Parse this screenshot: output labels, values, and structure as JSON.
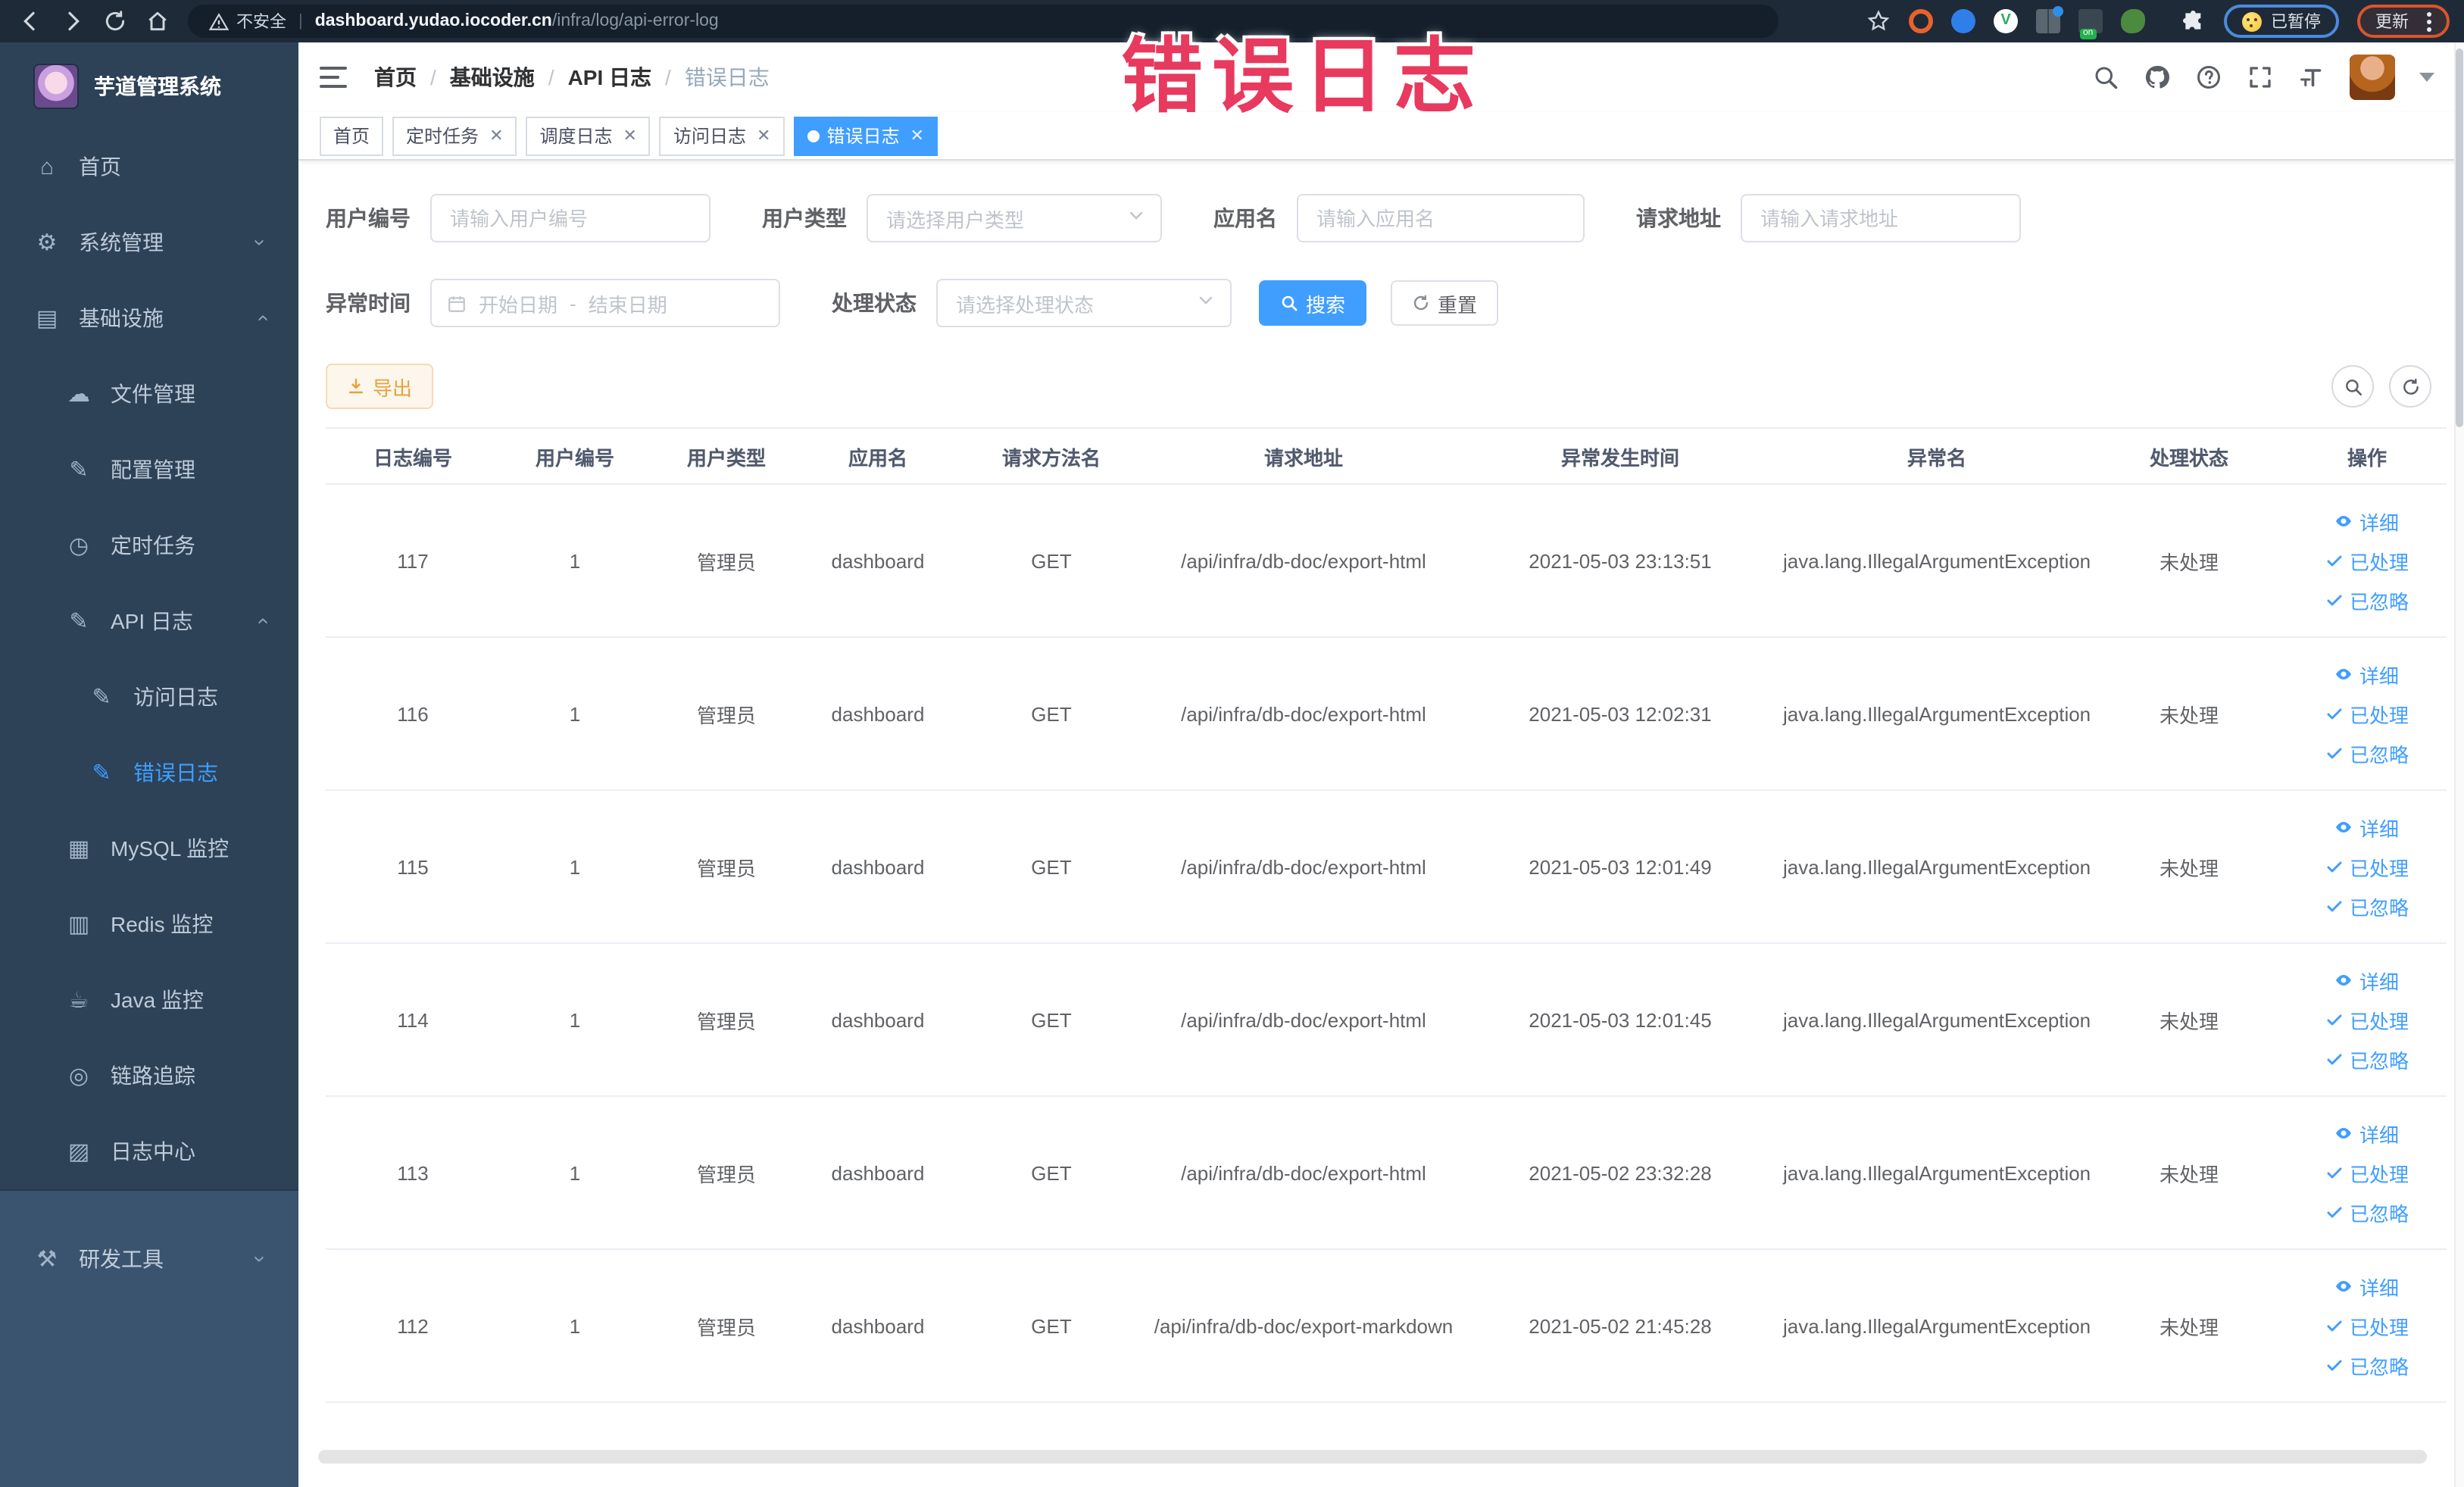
{
  "browser": {
    "security_label": "不安全",
    "url": {
      "domain": "dashboard.yudao.iocoder.cn",
      "path": "/infra/log/api-error-log"
    },
    "paused_pill_label": "已暂停",
    "update_pill_label": "更新",
    "nav_icons": [
      "back-icon",
      "forward-icon",
      "reload-icon",
      "home-icon"
    ],
    "extension_icons": [
      "bookmark-star-icon",
      "ext-orange-icon",
      "ext-blue-icon",
      "ext-green-v-icon",
      "ext-grid-icon",
      "ext-on-icon",
      "ext-plant-icon",
      "puzzle-icon"
    ]
  },
  "stamp_text": "错误日志",
  "sidebar": {
    "title": "芋道管理系统",
    "menu": [
      {
        "id": "home",
        "label": "首页",
        "icon": "home-icon",
        "glyph": "⌂",
        "level": 1
      },
      {
        "id": "system-mgmt",
        "label": "系统管理",
        "icon": "gear-icon",
        "glyph": "⚙",
        "level": 1,
        "chevron": "down"
      },
      {
        "id": "infrastructure",
        "label": "基础设施",
        "icon": "monitor-icon",
        "glyph": "▤",
        "level": 1,
        "chevron": "up"
      },
      {
        "id": "file-mgmt",
        "label": "文件管理",
        "icon": "cloud-upload-icon",
        "glyph": "☁",
        "level": 2
      },
      {
        "id": "config-mgmt",
        "label": "配置管理",
        "icon": "edit-icon",
        "glyph": "✎",
        "level": 2
      },
      {
        "id": "cron-job",
        "label": "定时任务",
        "icon": "timer-icon",
        "glyph": "◷",
        "level": 2
      },
      {
        "id": "api-log",
        "label": "API 日志",
        "icon": "document-edit-icon",
        "glyph": "✎",
        "level": 2,
        "chevron": "up"
      },
      {
        "id": "access-log",
        "label": "访问日志",
        "icon": "document-edit-icon",
        "glyph": "✎",
        "level": 3
      },
      {
        "id": "error-log",
        "label": "错误日志",
        "icon": "document-edit-icon",
        "glyph": "✎",
        "level": 3,
        "active": true
      },
      {
        "id": "mysql-monitor",
        "label": "MySQL 监控",
        "icon": "database-icon",
        "glyph": "▦",
        "level": 2
      },
      {
        "id": "redis-monitor",
        "label": "Redis 监控",
        "icon": "layers-icon",
        "glyph": "▥",
        "level": 2
      },
      {
        "id": "java-monitor",
        "label": "Java 监控",
        "icon": "coffee-icon",
        "glyph": "☕",
        "level": 2
      },
      {
        "id": "trace",
        "label": "链路追踪",
        "icon": "eye-icon",
        "glyph": "◎",
        "level": 2
      },
      {
        "id": "log-center",
        "label": "日志中心",
        "icon": "log-icon",
        "glyph": "▨",
        "level": 2
      },
      {
        "id": "dev-tools",
        "label": "研发工具",
        "icon": "toolbox-icon",
        "glyph": "⚒",
        "level": 1,
        "chevron": "down",
        "section_alt": true
      }
    ]
  },
  "header": {
    "breadcrumb": [
      {
        "label": "首页"
      },
      {
        "label": "基础设施"
      },
      {
        "label": "API 日志"
      },
      {
        "label": "错误日志",
        "current": true
      }
    ],
    "right_icons": [
      "search-icon",
      "github-icon",
      "help-icon",
      "fullscreen-icon",
      "font-size-icon"
    ]
  },
  "tabs": [
    {
      "label": "首页",
      "closable": false,
      "active": false
    },
    {
      "label": "定时任务",
      "closable": true,
      "active": false
    },
    {
      "label": "调度日志",
      "closable": true,
      "active": false
    },
    {
      "label": "访问日志",
      "closable": true,
      "active": false
    },
    {
      "label": "错误日志",
      "closable": true,
      "active": true
    }
  ],
  "filters": {
    "user_id": {
      "label": "用户编号",
      "placeholder": "请输入用户编号"
    },
    "user_type": {
      "label": "用户类型",
      "placeholder": "请选择用户类型"
    },
    "app_name": {
      "label": "应用名",
      "placeholder": "请输入应用名"
    },
    "request_url": {
      "label": "请求地址",
      "placeholder": "请输入请求地址"
    },
    "exception_time": {
      "label": "异常时间",
      "start_placeholder": "开始日期",
      "separator": "-",
      "end_placeholder": "结束日期"
    },
    "process_status": {
      "label": "处理状态",
      "placeholder": "请选择处理状态"
    },
    "search_label": "搜索",
    "reset_label": "重置"
  },
  "toolbar": {
    "export_label": "导出",
    "circle_buttons": [
      "search-toggle-icon",
      "refresh-icon"
    ]
  },
  "table": {
    "columns": [
      "日志编号",
      "用户编号",
      "用户类型",
      "应用名",
      "请求方法名",
      "请求地址",
      "异常发生时间",
      "异常名",
      "处理状态",
      "操作"
    ],
    "row_actions": [
      {
        "label": "详细",
        "icon": "eye-icon"
      },
      {
        "label": "已处理",
        "icon": "check-icon"
      },
      {
        "label": "已忽略",
        "icon": "check-icon"
      }
    ],
    "rows": [
      {
        "id": "117",
        "user_id": "1",
        "user_type": "管理员",
        "app": "dashboard",
        "method": "GET",
        "url": "/api/infra/db-doc/export-html",
        "time": "2021-05-03 23:13:51",
        "exception": "java.lang.IllegalArgumentException",
        "status": "未处理"
      },
      {
        "id": "116",
        "user_id": "1",
        "user_type": "管理员",
        "app": "dashboard",
        "method": "GET",
        "url": "/api/infra/db-doc/export-html",
        "time": "2021-05-03 12:02:31",
        "exception": "java.lang.IllegalArgumentException",
        "status": "未处理"
      },
      {
        "id": "115",
        "user_id": "1",
        "user_type": "管理员",
        "app": "dashboard",
        "method": "GET",
        "url": "/api/infra/db-doc/export-html",
        "time": "2021-05-03 12:01:49",
        "exception": "java.lang.IllegalArgumentException",
        "status": "未处理"
      },
      {
        "id": "114",
        "user_id": "1",
        "user_type": "管理员",
        "app": "dashboard",
        "method": "GET",
        "url": "/api/infra/db-doc/export-html",
        "time": "2021-05-03 12:01:45",
        "exception": "java.lang.IllegalArgumentException",
        "status": "未处理"
      },
      {
        "id": "113",
        "user_id": "1",
        "user_type": "管理员",
        "app": "dashboard",
        "method": "GET",
        "url": "/api/infra/db-doc/export-html",
        "time": "2021-05-02 23:32:28",
        "exception": "java.lang.IllegalArgumentException",
        "status": "未处理"
      },
      {
        "id": "112",
        "user_id": "1",
        "user_type": "管理员",
        "app": "dashboard",
        "method": "GET",
        "url": "/api/infra/db-doc/export-markdown",
        "time": "2021-05-02 21:45:28",
        "exception": "java.lang.IllegalArgumentException",
        "status": "未处理"
      }
    ]
  },
  "colors": {
    "accent": "#409eff",
    "stamp": "#e8395e",
    "sidebar_bg": "#2d4257",
    "warn_btn_text": "#e6a23c"
  }
}
